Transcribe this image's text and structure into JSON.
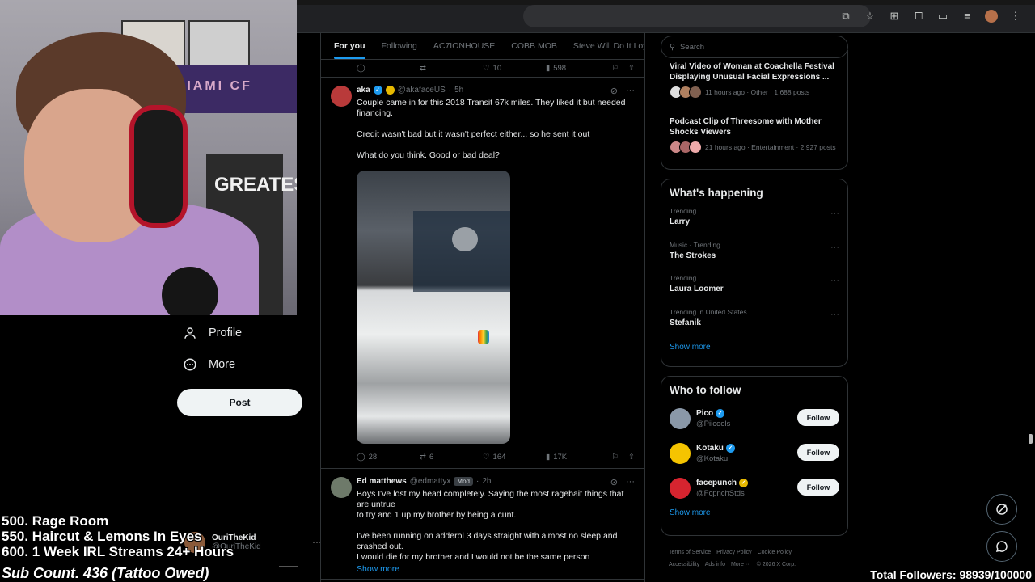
{
  "browser": {
    "icons": [
      "cast-icon",
      "star-icon",
      "extensions-icon",
      "puzzle-icon",
      "sidebar-icon",
      "media-icon",
      "profile-icon",
      "menu-icon"
    ]
  },
  "left_nav": {
    "items": [
      {
        "label": "Profile",
        "icon": "person-icon"
      },
      {
        "label": "More",
        "icon": "more-circle-icon"
      }
    ],
    "post_label": "Post",
    "account": {
      "name": "OuriTheKid",
      "handle": "@OuriTheKid"
    }
  },
  "overlay": {
    "goals": [
      "500. Rage Room",
      "550. Haircut & Lemons In Eyes",
      "600. 1 Week IRL Streams 24+ Hours"
    ],
    "sub_count": "Sub Count. 436 (Tattoo Owed)",
    "followers": "Total Followers: 98939/100000"
  },
  "webcam": {
    "flag_text": "MIAMI CF",
    "poster_text": "GREATEST"
  },
  "feed": {
    "tabs": [
      "For you",
      "Following",
      "AC7IONHOUSE",
      "COBB MOB",
      "Steve Will Do It Loyal"
    ],
    "prev_actions": {
      "replies": "",
      "reposts": "",
      "likes": "10",
      "views": "598"
    },
    "tweets": [
      {
        "name": "aka",
        "handle": "@akafaceUS",
        "time": "5h",
        "text": "Couple came in for this 2018 Transit 67k miles. They liked it but needed financing.\n\nCredit wasn't bad but it wasn't perfect either... so he sent it out\n\nWhat do you think. Good or bad deal?",
        "replies": "28",
        "reposts": "6",
        "likes": "164",
        "views": "17K"
      },
      {
        "name": "Ed matthews",
        "handle": "@edmattyx",
        "badge": "Mod",
        "time": "2h",
        "text": "Boys I've lost my head completely. Saying the most  ragebait things that are untrue\n to try and 1 up my brother by being a cunt.\n\nI've been running on adderol 3 days straight with almost no sleep and crashed out.\nI would die for my brother and I would not be the same person",
        "show_more": "Show more"
      }
    ]
  },
  "sidebar": {
    "search_placeholder": "Search",
    "news": [
      {
        "title": "Viral Video of Woman at Coachella Festival Displaying Unusual Facial Expressions ...",
        "meta": "11 hours ago · Other · 1,688 posts"
      },
      {
        "title": "Podcast Clip of Threesome with Mother Shocks Viewers",
        "meta": "21 hours ago · Entertainment · 2,927 posts"
      }
    ],
    "happening": {
      "title": "What's happening",
      "trends": [
        {
          "context": "Trending",
          "name": "Larry"
        },
        {
          "context": "Music · Trending",
          "name": "The Strokes"
        },
        {
          "context": "Trending",
          "name": "Laura Loomer"
        },
        {
          "context": "Trending in United States",
          "name": "Stefanik"
        }
      ],
      "show_more": "Show more"
    },
    "who_to_follow": {
      "title": "Who to follow",
      "accounts": [
        {
          "name": "Pico",
          "handle": "@Piicools",
          "button": "Follow",
          "color": "#8a98a8"
        },
        {
          "name": "Kotaku",
          "handle": "@Kotaku",
          "button": "Follow",
          "color": "#f5c400"
        },
        {
          "name": "facepunch",
          "handle": "@FcpnchStds",
          "button": "Follow",
          "color": "#d6242f"
        }
      ],
      "show_more": "Show more"
    },
    "footer": {
      "links": [
        "Terms of Service",
        "Privacy Policy",
        "Cookie Policy",
        "Accessibility",
        "Ads info",
        "More ···",
        "© 2026 X Corp."
      ]
    }
  },
  "colors": {
    "accent": "#1d9bf0",
    "background": "#000000",
    "border": "#2f3336",
    "muted": "#71767b"
  }
}
